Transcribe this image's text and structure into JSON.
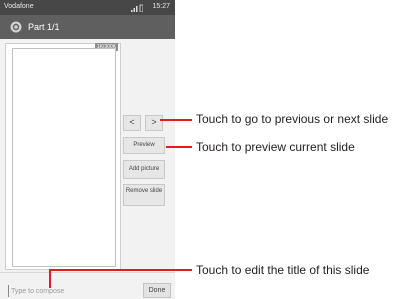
{
  "status_bar": {
    "carrier": "Vodafone",
    "time": "15:27"
  },
  "app_bar": {
    "title": "Part 1/1"
  },
  "slide": {
    "size_counter": "1K/300K"
  },
  "controls": {
    "prev_label": "<",
    "next_label": ">",
    "preview_label": "Preview",
    "add_picture_label": "Add picture",
    "remove_slide_label": "Remove slide"
  },
  "compose": {
    "placeholder": "Type to compose",
    "done_label": "Done"
  },
  "callouts": [
    {
      "text": "Touch to go to previous or next slide"
    },
    {
      "text": "Touch to preview current slide"
    },
    {
      "text": "Touch to edit the title of this slide"
    }
  ],
  "colors": {
    "callout_line": "#e31b23",
    "app_bar": "#5f5f5f",
    "status_bar": "#474747"
  },
  "icons": [
    "signal-icon",
    "battery-icon",
    "app-icon"
  ]
}
